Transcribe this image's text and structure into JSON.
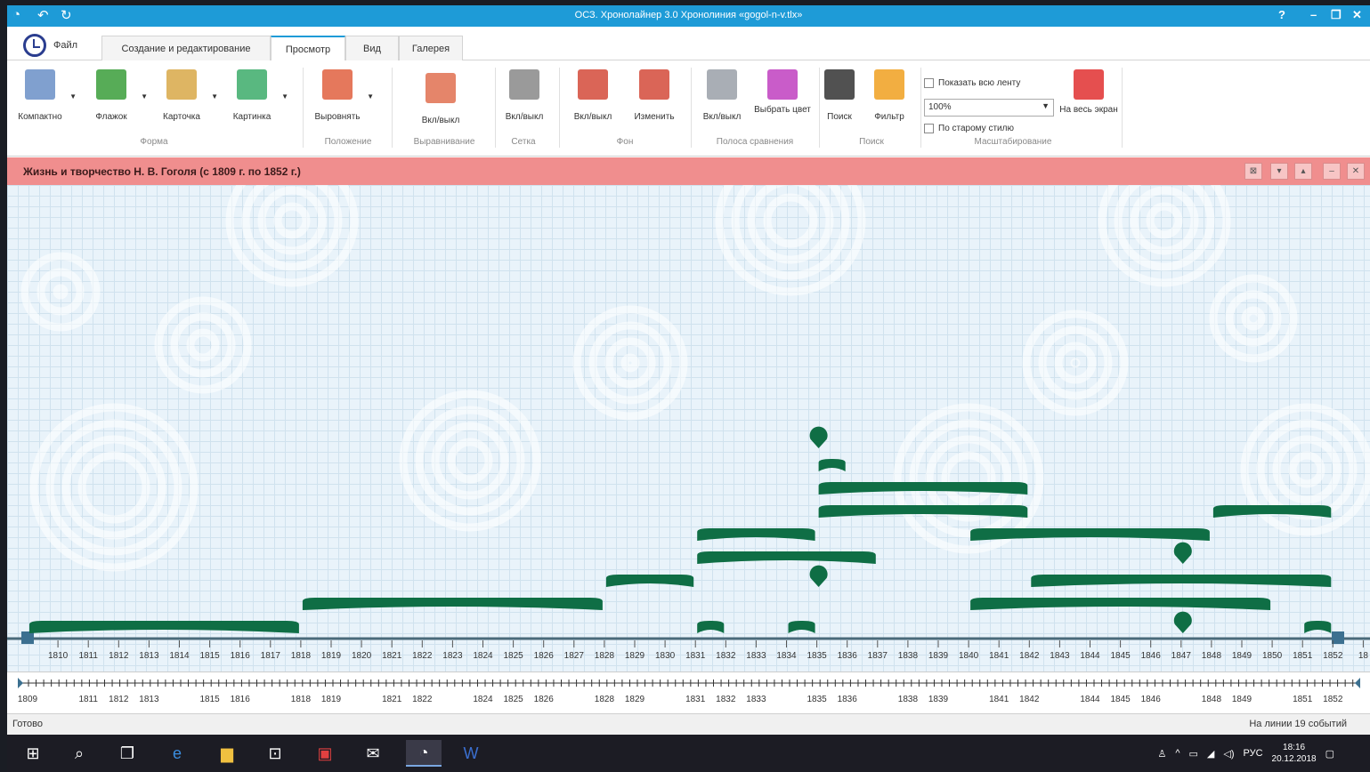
{
  "window": {
    "title": "ОСЗ. Хронолайнер 3.0 Хронолиния «gogol-n-v.tlx»",
    "help": "?",
    "minimize": "–",
    "restore": "❐",
    "close": "✕"
  },
  "tabs": [
    {
      "label": "Файл"
    },
    {
      "label": "Создание и редактирование"
    },
    {
      "label": "Просмотр"
    },
    {
      "label": "Вид"
    },
    {
      "label": "Галерея"
    }
  ],
  "ribbon": {
    "buttons": [
      {
        "label": "Компактно",
        "color": "#6a8fc7"
      },
      {
        "label": "Флажок",
        "color": "#3a9d3a"
      },
      {
        "label": "Карточка",
        "color": "#d8a848"
      },
      {
        "label": "Картинка",
        "color": "#3cab6a"
      },
      {
        "label": "Выровнять",
        "color": "#e06040"
      },
      {
        "label": "Вкл/выкл",
        "color": "#e07050"
      },
      {
        "label": "Вкл/выкл",
        "color": "#888888"
      },
      {
        "label": "Вкл/выкл",
        "color": "#d44a3a"
      },
      {
        "label": "Изменить",
        "color": "#d44a3a"
      },
      {
        "label": "Вкл/выкл",
        "color": "#9aa0a8"
      },
      {
        "label": "Выбрать цвет",
        "color": "#c040c0"
      },
      {
        "label": "Поиск",
        "color": "#333333"
      },
      {
        "label": "Фильтр",
        "color": "#f0a020"
      },
      {
        "label": "На весь экран",
        "color": "#e03030"
      }
    ],
    "groups": [
      "Форма",
      "Положение",
      "Выравнивание",
      "Сетка",
      "Фон",
      "Полоса сравнения",
      "Поиск",
      "Масштабирование"
    ],
    "show_all_label": "Показать всю ленту",
    "zoom_value": "100%",
    "old_style_label": "По старому стилю"
  },
  "timeline": {
    "title": "Жизнь и творчество Н. В. Гоголя (с 1809 г. по 1852 г.)",
    "years": [
      "1810",
      "1811",
      "1812",
      "1813",
      "1814",
      "1815",
      "1816",
      "1817",
      "1818",
      "1819",
      "1820",
      "1821",
      "1822",
      "1823",
      "1824",
      "1825",
      "1826",
      "1827",
      "1828",
      "1829",
      "1830",
      "1831",
      "1832",
      "1833",
      "1834",
      "1835",
      "1836",
      "1837",
      "1838",
      "1839",
      "1840",
      "1841",
      "1842",
      "1843",
      "1844",
      "1845",
      "1846",
      "1847",
      "1848",
      "1849",
      "1850",
      "1851",
      "1852",
      "18"
    ],
    "bar_color": "#0f6e45",
    "events": [
      {
        "start": 1809,
        "end": 1818,
        "level": 0
      },
      {
        "start": 1818,
        "end": 1828,
        "level": 1
      },
      {
        "start": 1828,
        "end": 1831,
        "level": 2
      },
      {
        "start": 1831,
        "end": 1832,
        "level": 0
      },
      {
        "start": 1834,
        "end": 1835,
        "level": 0
      },
      {
        "start": 1831,
        "end": 1837,
        "level": 3
      },
      {
        "start": 1831,
        "end": 1835,
        "level": 4
      },
      {
        "start": 1835,
        "end": 1842,
        "level": 5
      },
      {
        "start": 1835,
        "end": 1842,
        "level": 6
      },
      {
        "start": 1835,
        "end": 1836,
        "level": 7
      },
      {
        "start": 1840,
        "end": 1850,
        "level": 1
      },
      {
        "start": 1842,
        "end": 1852,
        "level": 2
      },
      {
        "start": 1840,
        "end": 1848,
        "level": 4
      },
      {
        "start": 1848,
        "end": 1852,
        "level": 5
      },
      {
        "start": 1851,
        "end": 1852,
        "level": 0
      }
    ],
    "points": [
      {
        "year": 1835,
        "level": 8
      },
      {
        "year": 1835,
        "level": 2
      },
      {
        "year": 1847,
        "level": 3
      },
      {
        "year": 1847,
        "level": 0
      }
    ]
  },
  "mini_scale": {
    "labels": [
      "1809",
      "1811",
      "1812",
      "1813",
      "1815",
      "1816",
      "1818",
      "1819",
      "1821",
      "1822",
      "1824",
      "1825",
      "1826",
      "1828",
      "1829",
      "1831",
      "1832",
      "1833",
      "1835",
      "1836",
      "1838",
      "1839",
      "1841",
      "1842",
      "1844",
      "1845",
      "1846",
      "1848",
      "1849",
      "1851",
      "1852"
    ]
  },
  "status": {
    "left": "Готово",
    "right": "На линии 19 событий"
  },
  "taskbar": {
    "lang": "РУС",
    "time": "18:16",
    "date": "20.12.2018"
  }
}
